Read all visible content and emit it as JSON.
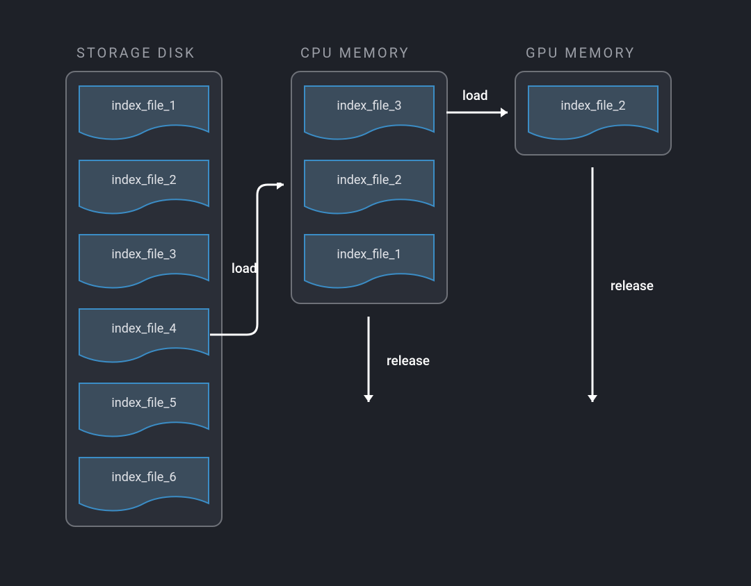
{
  "columns": {
    "storage": {
      "title": "STORAGE DISK",
      "files": [
        "index_file_1",
        "index_file_2",
        "index_file_3",
        "index_file_4",
        "index_file_5",
        "index_file_6"
      ]
    },
    "cpu": {
      "title": "CPU MEMORY",
      "files": [
        "index_file_3",
        "index_file_2",
        "index_file_1"
      ]
    },
    "gpu": {
      "title": "GPU MEMORY",
      "files": [
        "index_file_2"
      ]
    }
  },
  "arrows": {
    "storage_to_cpu_label": "load",
    "cpu_to_gpu_label": "load",
    "cpu_release_label": "release",
    "gpu_release_label": "release"
  },
  "colors": {
    "background": "#1e2128",
    "panel": "#2a2e37",
    "panelBorder": "#6e7178",
    "fileFill": "#3b4c5c",
    "fileStroke": "#3b8dc6",
    "titleText": "#9b9ea6",
    "fileText": "#e0e2e7",
    "arrow": "#ffffff"
  }
}
